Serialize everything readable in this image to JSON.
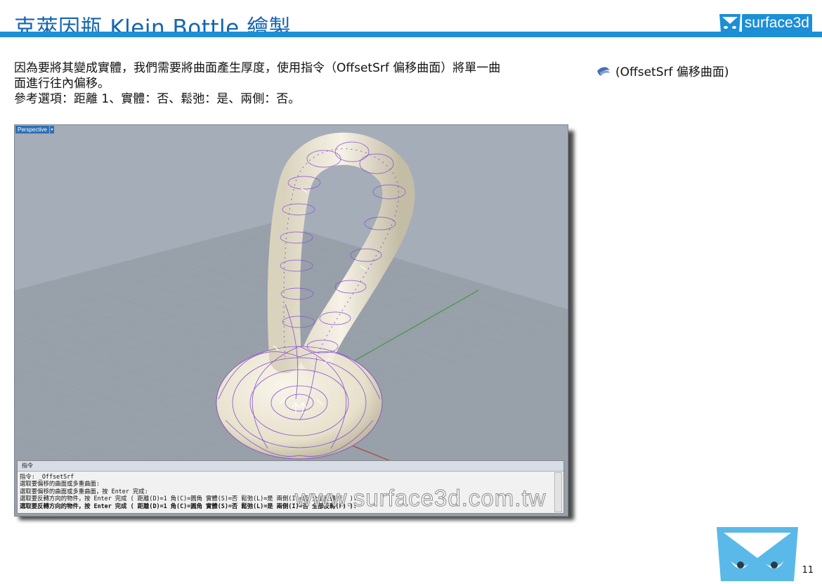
{
  "title": "克萊因瓶 Klein Bottle 繪製",
  "brand": {
    "text": "surface3d"
  },
  "body_lines": [
    "因為要將其變成實體，我們需要將曲面產生厚度，使用指令（OffsetSrf 偏移曲面）將單一曲",
    "面進行往內偏移。",
    "參考選項：距離 1、實體：否、鬆弛：是、兩側：否。"
  ],
  "side_ref": "(OffsetSrf 偏移曲面)",
  "viewport": {
    "label": "Perspective"
  },
  "command_panel": {
    "header": "指令",
    "lines": [
      "指令: _OffsetSrf",
      "選取要偏移的曲面或多重曲面:",
      "選取要偏移的曲面或多重曲面，按 Enter 完成:",
      "選取要反轉方向的物件，按 Enter 完成 ( 距離(D)=1  角(C)=圓角  實體(S)=否  鬆弛(L)=是  兩側(I)=否  全部反轉(F) ):",
      "選取要反轉方向的物件，按 Enter 完成 ( 距離(D)=1  角(C)=圓角  實體(S)=否  鬆弛(L)=是  兩側(I)=否  全部反轉(F) ):"
    ]
  },
  "watermark": "www.surface3d.com.tw",
  "page_number": "11",
  "colors": {
    "accent": "#1c8fd6",
    "title": "#1565b3",
    "viewport_bg": "#a5adb8",
    "surface": "#ebe6d3",
    "isocurve": "#8a4fd0"
  }
}
